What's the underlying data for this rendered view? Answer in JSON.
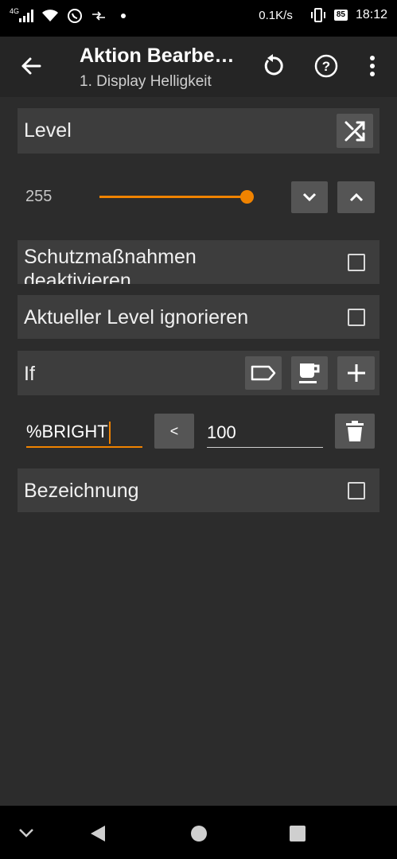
{
  "status_bar": {
    "network_label": "4G",
    "speed": "0.1K/s",
    "battery": "85",
    "time": "18:12"
  },
  "toolbar": {
    "title": "Aktion Bearbe…",
    "subtitle": "1. Display Helligkeit",
    "icons": [
      "back-arrow-icon",
      "undo-icon",
      "help-icon",
      "more-vert-icon"
    ]
  },
  "level": {
    "label": "Level",
    "value": "255",
    "slider_fraction": 1.0,
    "accent_color": "#f08300"
  },
  "options": {
    "schutz_label_line1": "Schutzmaßnahmen",
    "schutz_label_line2": "deaktivieren",
    "ignore_label": "Aktueller Level ignorieren",
    "bezeichnung_label": "Bezeichnung"
  },
  "condition": {
    "label": "If",
    "variable": "%BRIGHT",
    "operator": "<",
    "value": "100"
  }
}
